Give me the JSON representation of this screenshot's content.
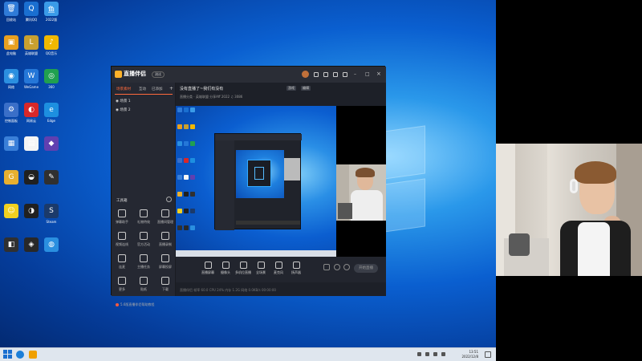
{
  "desktop_icons": [
    {
      "label": "回收站",
      "color": "#2f7bd8",
      "glyph": "🗑"
    },
    {
      "label": "腾讯QQ",
      "color": "#1a6fd0",
      "glyph": "Q"
    },
    {
      "label": "2022版",
      "color": "#3a9be8",
      "glyph": "鱼"
    },
    {
      "label": "此电脑",
      "color": "#e8a020",
      "glyph": "▣"
    },
    {
      "label": "英雄联盟",
      "color": "#c8a030",
      "glyph": "L"
    },
    {
      "label": "QQ音乐",
      "color": "#f0b800",
      "glyph": "♪"
    },
    {
      "label": "网络",
      "color": "#2b8fe0",
      "glyph": "◉"
    },
    {
      "label": "WeGame",
      "color": "#2577d8",
      "glyph": "W"
    },
    {
      "label": "360",
      "color": "#20a050",
      "glyph": "◎"
    },
    {
      "label": "控制面板",
      "color": "#3a6fc8",
      "glyph": "⚙"
    },
    {
      "label": "网易云",
      "color": "#d8282a",
      "glyph": "◐"
    },
    {
      "label": "Edge",
      "color": "#1d8fe0",
      "glyph": "e"
    },
    {
      "label": "",
      "color": "#3a7fd8",
      "glyph": "▦"
    },
    {
      "label": "",
      "color": "#f5f5f5",
      "glyph": "▤"
    },
    {
      "label": "",
      "color": "#6040b0",
      "glyph": "◆"
    },
    {
      "label": "",
      "color": "#e8b030",
      "glyph": "G"
    },
    {
      "label": "",
      "color": "#202020",
      "glyph": "◒"
    },
    {
      "label": "",
      "color": "#303030",
      "glyph": "✎"
    },
    {
      "label": "",
      "color": "#f0d020",
      "glyph": "☺"
    },
    {
      "label": "",
      "color": "#202020",
      "glyph": "◑"
    },
    {
      "label": "Steam",
      "color": "#1b3a6a",
      "glyph": "S"
    },
    {
      "label": "",
      "color": "#303030",
      "glyph": "◧"
    },
    {
      "label": "",
      "color": "#282828",
      "glyph": "◈"
    },
    {
      "label": "",
      "color": "#2a8fe0",
      "glyph": "◍"
    }
  ],
  "app": {
    "logo": "直播伴侣",
    "version": "测试",
    "left_tabs": [
      "场景素材",
      "互动",
      "已添加"
    ],
    "scenes": [
      "场景 1",
      "场景 2"
    ],
    "tools_title": "工具箱",
    "tools": [
      "弹幕助手",
      "礼物特效",
      "直播间管理",
      "视频连线",
      "官方活动",
      "直播录制",
      "连麦",
      "主播任务",
      "屏幕投屏",
      "更多",
      "贴纸",
      "下载"
    ],
    "footer": "5.6版直播伴侣帮助教程",
    "stream_title": "没有直播了~我们有没有",
    "tags": [
      "游戏",
      "编辑"
    ],
    "meta": "直播分类 · 英雄联盟   分享Aff   2022   ♫ 3086",
    "controls": [
      "直播屏幕",
      "摄像头",
      "多机位直播",
      "全场景",
      "麦克风",
      "扬声器"
    ],
    "start_label": "开始直播",
    "status": "直播伴侣    帧率 60.0    CPU 24%    内存 1.2G    网络 0.0KB/s    00:00:00"
  },
  "taskbar": {
    "time": "13:51",
    "date": "2022/12/8"
  }
}
